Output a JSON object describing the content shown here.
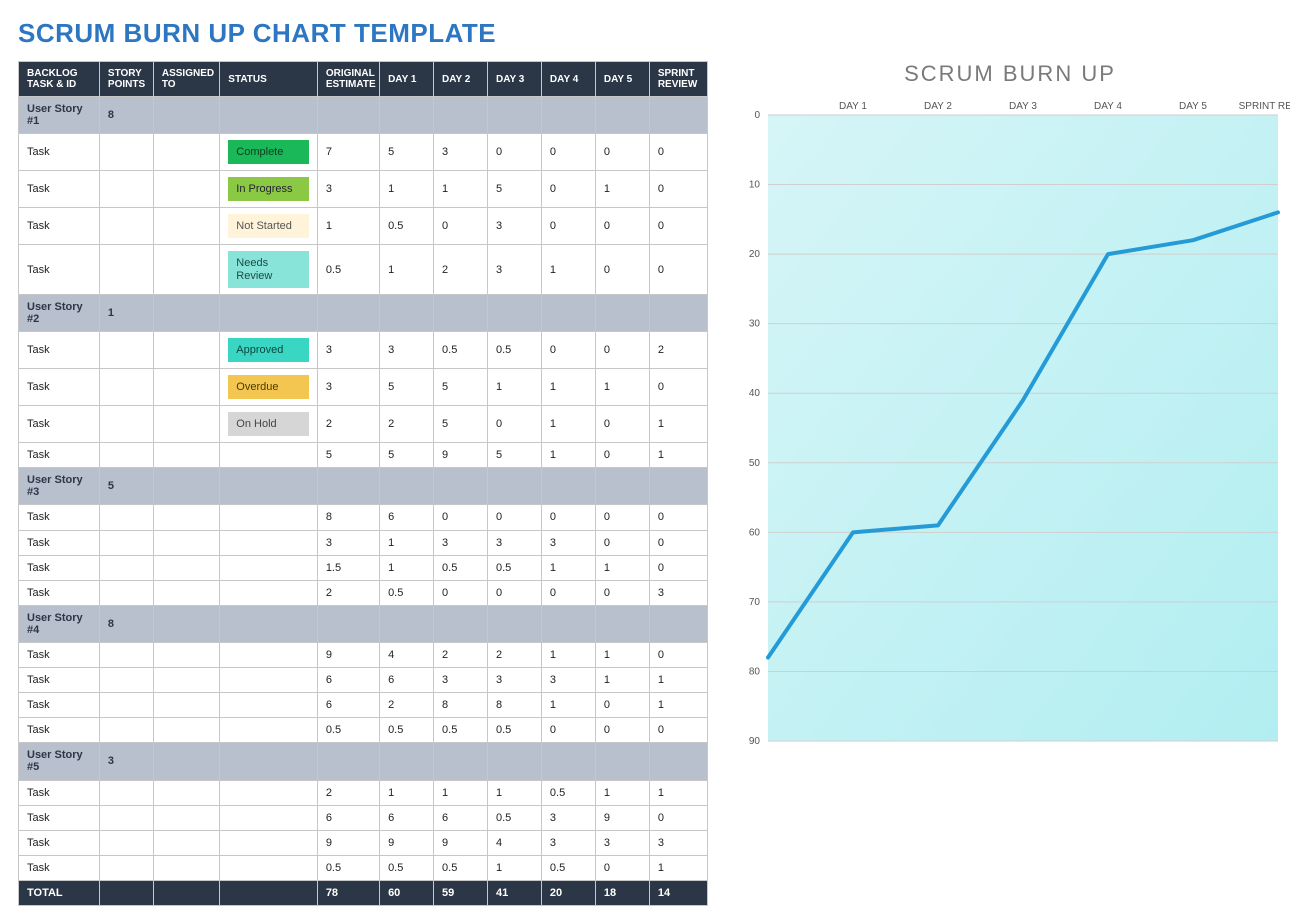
{
  "title": "SCRUM BURN UP CHART TEMPLATE",
  "headers": [
    "BACKLOG TASK & ID",
    "STORY POINTS",
    "ASSIGNED TO",
    "STATUS",
    "ORIGINAL ESTIMATE",
    "DAY 1",
    "DAY 2",
    "DAY 3",
    "DAY 4",
    "DAY 5",
    "SPRINT REVIEW"
  ],
  "status_classes": {
    "Complete": "status-complete",
    "In Progress": "status-inprogress",
    "Not Started": "status-notstarted",
    "Needs Review": "status-needsreview",
    "Approved": "status-approved",
    "Overdue": "status-overdue",
    "On Hold": "status-onhold"
  },
  "rows": [
    {
      "type": "story",
      "task": "User Story #1",
      "sp": "8"
    },
    {
      "type": "task",
      "task": "Task",
      "status": "Complete",
      "oe": "7",
      "d": [
        "5",
        "3",
        "0",
        "0",
        "0"
      ],
      "sr": "0"
    },
    {
      "type": "task",
      "task": "Task",
      "status": "In Progress",
      "oe": "3",
      "d": [
        "1",
        "1",
        "5",
        "0",
        "1"
      ],
      "sr": "0"
    },
    {
      "type": "task",
      "task": "Task",
      "status": "Not Started",
      "oe": "1",
      "d": [
        "0.5",
        "0",
        "3",
        "0",
        "0"
      ],
      "sr": "0"
    },
    {
      "type": "task",
      "task": "Task",
      "status": "Needs Review",
      "oe": "0.5",
      "d": [
        "1",
        "2",
        "3",
        "1",
        "0"
      ],
      "sr": "0"
    },
    {
      "type": "story",
      "task": "User Story #2",
      "sp": "1"
    },
    {
      "type": "task",
      "task": "Task",
      "status": "Approved",
      "oe": "3",
      "d": [
        "3",
        "0.5",
        "0.5",
        "0",
        "0"
      ],
      "sr": "2"
    },
    {
      "type": "task",
      "task": "Task",
      "status": "Overdue",
      "oe": "3",
      "d": [
        "5",
        "5",
        "1",
        "1",
        "1"
      ],
      "sr": "0"
    },
    {
      "type": "task",
      "task": "Task",
      "status": "On Hold",
      "oe": "2",
      "d": [
        "2",
        "5",
        "0",
        "1",
        "0"
      ],
      "sr": "1"
    },
    {
      "type": "task",
      "task": "Task",
      "status": "",
      "oe": "5",
      "d": [
        "5",
        "9",
        "5",
        "1",
        "0"
      ],
      "sr": "1"
    },
    {
      "type": "story",
      "task": "User Story #3",
      "sp": "5"
    },
    {
      "type": "task",
      "task": "Task",
      "status": "",
      "oe": "8",
      "d": [
        "6",
        "0",
        "0",
        "0",
        "0"
      ],
      "sr": "0"
    },
    {
      "type": "task",
      "task": "Task",
      "status": "",
      "oe": "3",
      "d": [
        "1",
        "3",
        "3",
        "3",
        "0"
      ],
      "sr": "0"
    },
    {
      "type": "task",
      "task": "Task",
      "status": "",
      "oe": "1.5",
      "d": [
        "1",
        "0.5",
        "0.5",
        "1",
        "1"
      ],
      "sr": "0"
    },
    {
      "type": "task",
      "task": "Task",
      "status": "",
      "oe": "2",
      "d": [
        "0.5",
        "0",
        "0",
        "0",
        "0"
      ],
      "sr": "3"
    },
    {
      "type": "story",
      "task": "User Story #4",
      "sp": "8"
    },
    {
      "type": "task",
      "task": "Task",
      "status": "",
      "oe": "9",
      "d": [
        "4",
        "2",
        "2",
        "1",
        "1"
      ],
      "sr": "0"
    },
    {
      "type": "task",
      "task": "Task",
      "status": "",
      "oe": "6",
      "d": [
        "6",
        "3",
        "3",
        "3",
        "1"
      ],
      "sr": "1"
    },
    {
      "type": "task",
      "task": "Task",
      "status": "",
      "oe": "6",
      "d": [
        "2",
        "8",
        "8",
        "1",
        "0"
      ],
      "sr": "1"
    },
    {
      "type": "task",
      "task": "Task",
      "status": "",
      "oe": "0.5",
      "d": [
        "0.5",
        "0.5",
        "0.5",
        "0",
        "0"
      ],
      "sr": "0"
    },
    {
      "type": "story",
      "task": "User Story #5",
      "sp": "3"
    },
    {
      "type": "task",
      "task": "Task",
      "status": "",
      "oe": "2",
      "d": [
        "1",
        "1",
        "1",
        "0.5",
        "1"
      ],
      "sr": "1"
    },
    {
      "type": "task",
      "task": "Task",
      "status": "",
      "oe": "6",
      "d": [
        "6",
        "6",
        "0.5",
        "3",
        "9"
      ],
      "sr": "0"
    },
    {
      "type": "task",
      "task": "Task",
      "status": "",
      "oe": "9",
      "d": [
        "9",
        "9",
        "4",
        "3",
        "3"
      ],
      "sr": "3"
    },
    {
      "type": "task",
      "task": "Task",
      "status": "",
      "oe": "0.5",
      "d": [
        "0.5",
        "0.5",
        "1",
        "0.5",
        "0"
      ],
      "sr": "1"
    }
  ],
  "total": {
    "label": "TOTAL",
    "oe": "78",
    "d": [
      "60",
      "59",
      "41",
      "20",
      "18"
    ],
    "sr": "14"
  },
  "chart_data": {
    "type": "line",
    "title": "SCRUM BURN UP",
    "categories": [
      "DAY 1",
      "DAY 2",
      "DAY 3",
      "DAY 4",
      "DAY 5",
      "SPRINT REVIEW"
    ],
    "values": [
      78,
      60,
      59,
      41,
      20,
      18,
      14
    ],
    "x_positions": [
      0,
      1,
      2,
      3,
      4,
      5,
      6
    ],
    "ylim": [
      0,
      90
    ],
    "y_reversed": true,
    "y_ticks": [
      0,
      10,
      20,
      30,
      40,
      50,
      60,
      70,
      80,
      90
    ],
    "xlabel": "",
    "ylabel": ""
  }
}
